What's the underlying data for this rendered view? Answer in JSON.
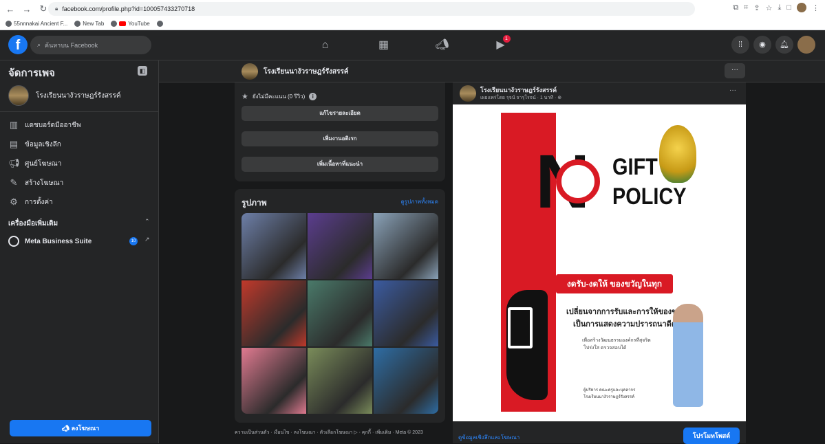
{
  "browser": {
    "url": "facebook.com/profile.php?id=100057433270718",
    "bookmarks": [
      "55nnnakai Ancient F...",
      "New Tab",
      "YouTube"
    ]
  },
  "fb": {
    "search_placeholder": "ค้นหาบน Facebook",
    "watch_badge": "1"
  },
  "sidebar": {
    "title": "จัดการเพจ",
    "page_name": "โรงเรียนนางัวราษฎร์รังสรรค์",
    "items": [
      {
        "icon": "dashboard-icon",
        "label": "แดชบอร์ดมืออาชีพ"
      },
      {
        "icon": "insights-icon",
        "label": "ข้อมูลเชิงลึก"
      },
      {
        "icon": "megaphone-icon",
        "label": "ศูนย์โฆษณา"
      },
      {
        "icon": "edit-icon",
        "label": "สร้างโฆษณา"
      },
      {
        "icon": "gear-icon",
        "label": "การตั้งค่า"
      }
    ],
    "tools_label": "เครื่องมือเพิ่มเติม",
    "meta_suite": "Meta Business Suite",
    "meta_badge": "10",
    "cta": "ลงโฆษณา"
  },
  "page_bar": {
    "name": "โรงเรียนนางัวราษฎร์รังสรรค์",
    "more": "···"
  },
  "intro_card": {
    "rating": "ยังไม่มีคะแนน (0 รีวิว)",
    "buttons": [
      "แก้ไขรายละเอียด",
      "เพิ่มงานอดิเรก",
      "เพิ่มเนื้อหาที่แนะนำ"
    ]
  },
  "photos": {
    "title": "รูปภาพ",
    "see_all": "ดูรูปภาพทั้งหมด",
    "colors": [
      "#6d7fa8",
      "#5b3d8e",
      "#8aa2b8",
      "#c0392b",
      "#4a7a6a",
      "#3b5ba0",
      "#e07a90",
      "#7a8c5a",
      "#2e6da4"
    ]
  },
  "footer": "ความเป็นส่วนตัว · เงื่อนไข · ลงโฆษณา · ตัวเลือกโฆษณา ▷ · คุกกี้ · เพิ่มเติม · Meta © 2023",
  "post": {
    "author": "โรงเรียนนางัวราษฎร์รังสรรค์",
    "meta": "เผยแพร่โดย รุจน์ จารุโรจน์ · 1 นาที · ⊕",
    "more": "···",
    "poster": {
      "gift_title": "GIFT\nPOLICY",
      "banner": "งดรับ-งดให้ ของขวัญในทุกเทศกาล",
      "line1": "เปลี่ยนจากการรับและการให้ของขวัญ",
      "line2": "เป็นการแสดงความปรารถนาดีต่อกัน",
      "line3": "เพื่อสร้างวัฒนธรรมองค์กรที่สุจริต",
      "line4": "โปร่งใส ตรวจสอบได้",
      "sign1": "ผู้บริหาร คณะครูและบุคลากร",
      "sign2": "โรงเรียนนางัวราษฎร์รังสรรค์"
    },
    "insights_link": "ดูข้อมูลเชิงลึกและโฆษณา",
    "boost": "โปรโมทโพสต์"
  }
}
